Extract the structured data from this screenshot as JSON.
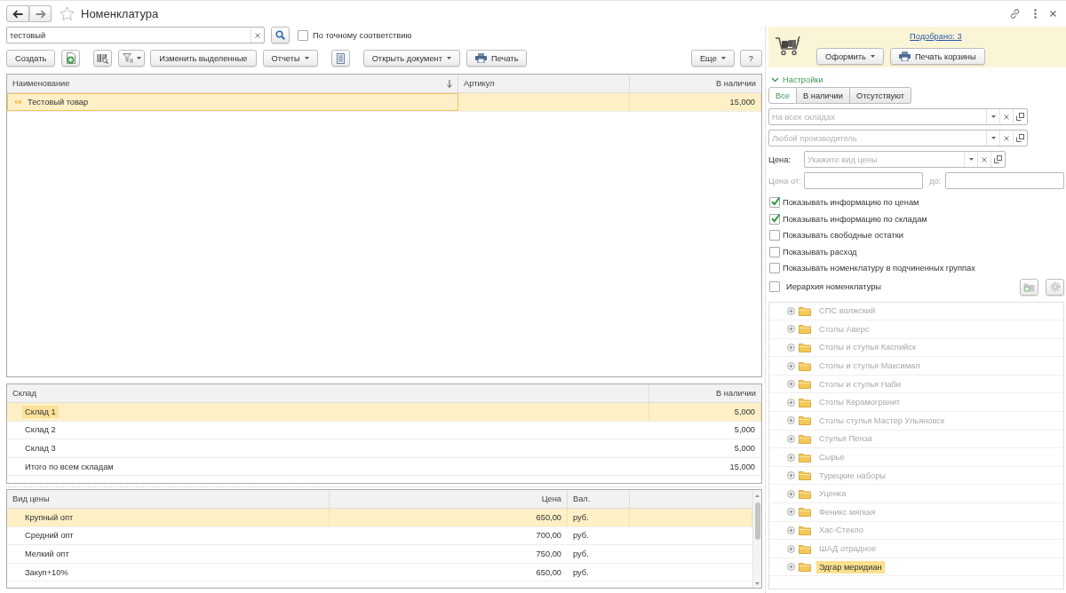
{
  "window": {
    "title": "Номенклатура"
  },
  "search": {
    "value": "тестовый",
    "exact_match": {
      "label": "По точному соответствию",
      "checked": false
    }
  },
  "toolbar": {
    "buttons": [
      {
        "label": "Создать",
        "dropdown": false
      },
      {
        "label": "Изменить выделенные",
        "dropdown": false
      },
      {
        "label": "Отчеты",
        "dropdown": true
      },
      {
        "label": "Открыть документ",
        "dropdown": true
      },
      {
        "label": "Печать",
        "dropdown": false
      }
    ],
    "right_buttons": [
      {
        "label": "Еще",
        "dropdown": true
      },
      {
        "label": "?",
        "dropdown": false
      }
    ]
  },
  "products": {
    "columns": [
      {
        "label": "Наименование",
        "sorted": true
      },
      {
        "label": "Артикул",
        "sorted": false
      },
      {
        "label": "В наличии",
        "sorted": false
      }
    ],
    "rows": [
      {
        "name": "Тестовый товар",
        "in_stock": "15,000",
        "selected": true
      }
    ]
  },
  "stock": {
    "columns": [
      "Склад",
      "В наличии"
    ],
    "rows": [
      {
        "warehouse": "Склад 1",
        "in_stock": "5,000",
        "selected": true
      },
      {
        "warehouse": "Склад 2",
        "in_stock": "5,000",
        "selected": false
      },
      {
        "warehouse": "Склад 3",
        "in_stock": "5,000",
        "selected": false
      },
      {
        "warehouse": "Итого по всем складам",
        "in_stock": "15,000",
        "selected": false
      }
    ]
  },
  "prices": {
    "columns": [
      "Вид цены",
      "Цена",
      "Вал."
    ],
    "rows": [
      {
        "price_type": "Крупный опт",
        "price": "650,00",
        "currency": "руб.",
        "selected": true
      },
      {
        "price_type": "Средний опт",
        "price": "700,00",
        "currency": "руб.",
        "selected": false
      },
      {
        "price_type": "Мелкий опт",
        "price": "750,00",
        "currency": "руб.",
        "selected": false
      },
      {
        "price_type": "Закуп+10%",
        "price": "650,00",
        "currency": "руб.",
        "selected": false
      }
    ]
  },
  "cart": {
    "link": "Подобрано: 3",
    "buttons": [
      {
        "label": "Оформить",
        "dropdown": true
      },
      {
        "label": "Печать корзины",
        "dropdown": false
      }
    ]
  },
  "settings": {
    "title": "Настройки",
    "expanded": true,
    "availability_tabs": [
      {
        "label": "Все",
        "selected": true
      },
      {
        "label": "В наличии",
        "selected": false
      },
      {
        "label": "Отсутствуют",
        "selected": false
      }
    ],
    "warehouse": {
      "placeholder": "На всех складах"
    },
    "manufacturer": {
      "placeholder": "Любой производитель"
    },
    "price_type": {
      "label": "Цена:",
      "placeholder": "Укажите вид цены"
    },
    "price_range": {
      "from_label": "Цена от:",
      "to_label": "до:",
      "disabled": true
    },
    "options": [
      {
        "label": "Показывать информацию по ценам",
        "checked": true
      },
      {
        "label": "Показывать информацию по складам",
        "checked": true
      },
      {
        "label": "Показывать свободные остатки",
        "checked": false
      },
      {
        "label": "Показывать расход",
        "checked": false
      },
      {
        "label": "Показывать номенклатуру в подчиненных группах",
        "checked": false
      }
    ]
  },
  "hierarchy": {
    "label": "Иерархия номенклатуры",
    "checked": false,
    "groups": [
      {
        "label": "СПС волжский",
        "expanded": false,
        "selected": false
      },
      {
        "label": "Столы Аверс",
        "expanded": false,
        "selected": false
      },
      {
        "label": "Столы и стулья Каспийск",
        "expanded": false,
        "selected": false
      },
      {
        "label": "Столы и стулья Максимал",
        "expanded": false,
        "selected": false
      },
      {
        "label": "Столы и стулья Наби",
        "expanded": false,
        "selected": false
      },
      {
        "label": "Столы Керамогранит",
        "expanded": false,
        "selected": false
      },
      {
        "label": "Столы стулья Мастер Ульяновск",
        "expanded": false,
        "selected": false
      },
      {
        "label": "Стулья Пенза",
        "expanded": false,
        "selected": false
      },
      {
        "label": "Сырье",
        "expanded": false,
        "selected": false
      },
      {
        "label": "Турецкие наборы",
        "expanded": false,
        "selected": false
      },
      {
        "label": "Уценка",
        "expanded": false,
        "selected": false
      },
      {
        "label": "Феникс мягкая",
        "expanded": false,
        "selected": false
      },
      {
        "label": "Хас-Стекло",
        "expanded": false,
        "selected": false
      },
      {
        "label": "ШАД отрадное",
        "expanded": false,
        "selected": false
      },
      {
        "label": "Эдгар меридиан",
        "expanded": false,
        "selected": true
      }
    ]
  }
}
